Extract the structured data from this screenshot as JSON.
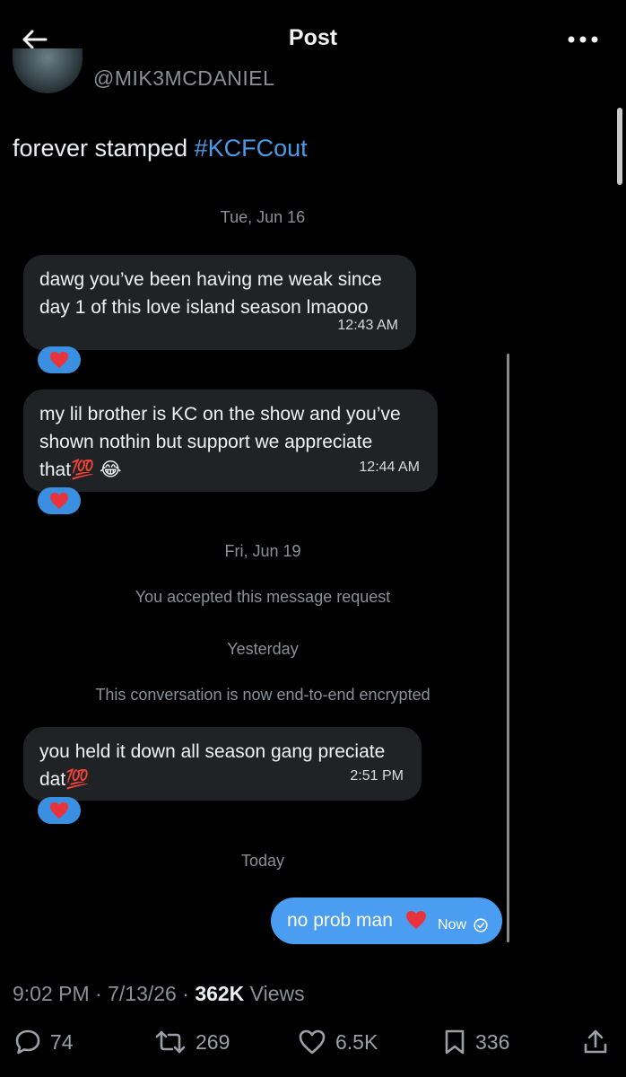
{
  "header": {
    "title": "Post"
  },
  "author": {
    "handle": "@MIK3MCDANIEL"
  },
  "tweet": {
    "text": "forever stamped ",
    "hashtag": "#KCFCout"
  },
  "conversation": {
    "date_1": "Tue, Jun 16",
    "msg_1": "dawg you’ve been having me weak since\nday 1 of this love island season lmaooo",
    "msg_1_time": "12:43 AM",
    "msg_2": "my lil brother is KC on the show and you’ve\nshown nothin but support we appreciate\nthat💯 😂",
    "msg_2_time": "12:44 AM",
    "date_2": "Fri, Jun 19",
    "request_notice": "You accepted this message request",
    "date_3": "Yesterday",
    "encryption_notice": "This conversation is now end-to-end encrypted",
    "msg_3": "you held it down all season gang preciate\ndat💯",
    "msg_3_time": "2:51 PM",
    "date_4": "Today",
    "sent_msg": "no prob man",
    "sent_time": "Now"
  },
  "meta": {
    "time": "9:02 PM",
    "date": "7/13/26",
    "separator": "·",
    "views": "362K",
    "views_label": " Views"
  },
  "actions": {
    "replies": "74",
    "reposts": "269",
    "likes": "6.5K",
    "bookmarks": "336"
  },
  "icons": {
    "back": "arrow-left-icon",
    "more": "more-dots-icon",
    "reaction": "heart-icon",
    "reply": "reply-icon",
    "repost": "repost-icon",
    "like": "like-icon",
    "bookmark": "bookmark-icon",
    "share": "share-icon"
  },
  "colors": {
    "background": "#000000",
    "bubble": "#202326",
    "accent": "#4a9df0",
    "hashtag": "#4b9be8",
    "muted": "#8b9196"
  }
}
